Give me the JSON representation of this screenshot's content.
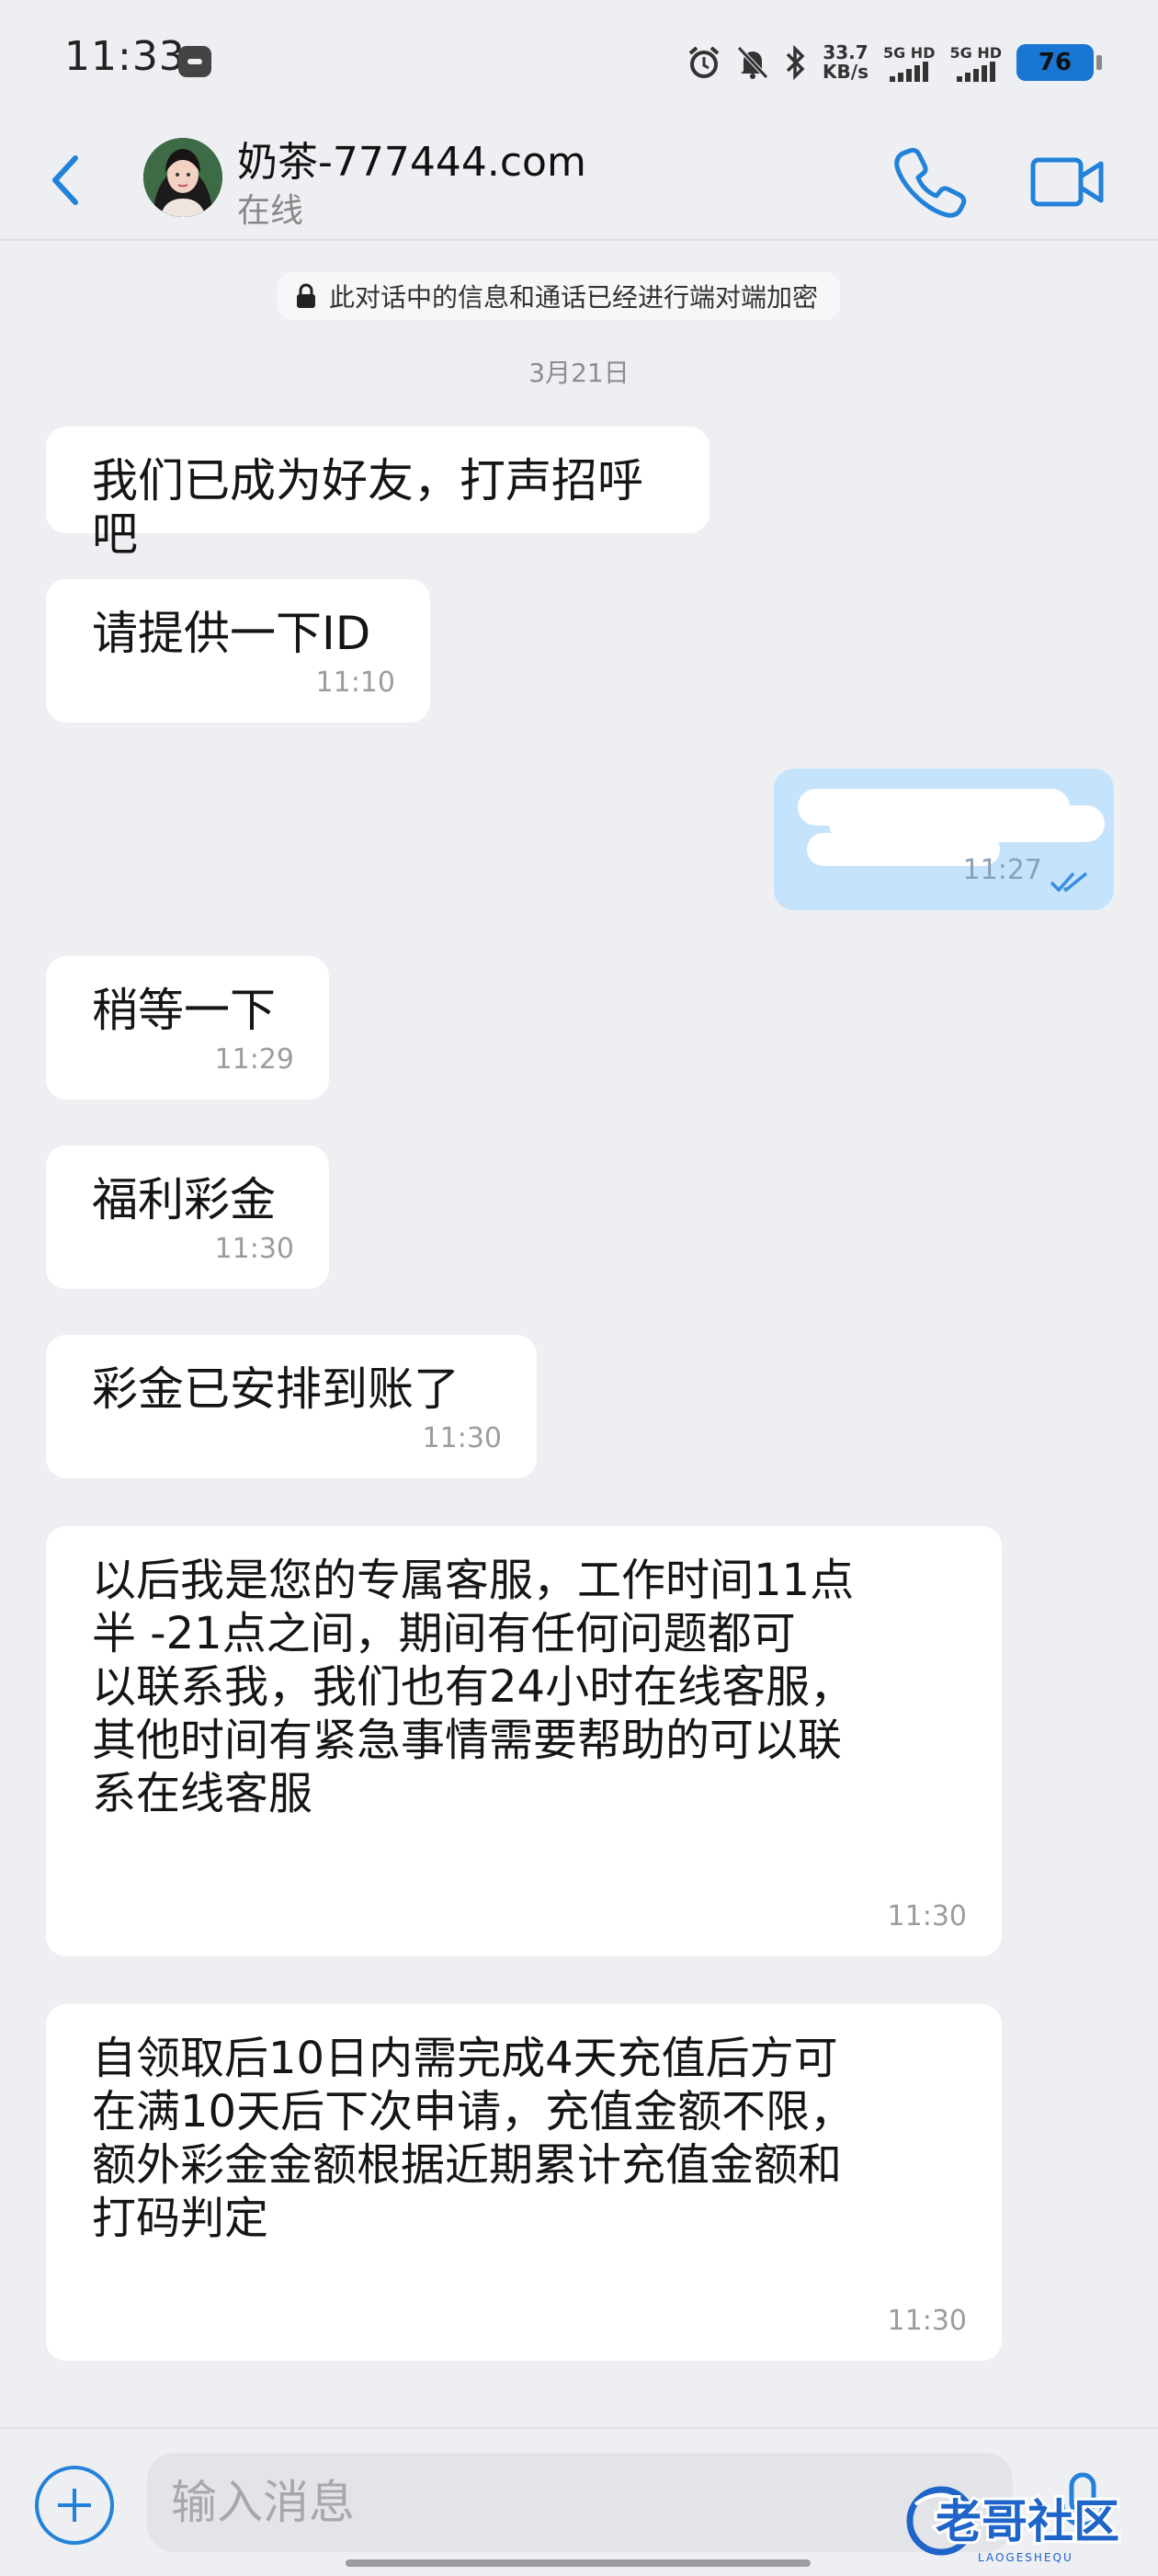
{
  "status_bar": {
    "time": "11:33",
    "net_speed_value": "33.7",
    "net_speed_unit": "KB/s",
    "sim1_label": "5G HD",
    "sim2_label": "5G HD",
    "battery_level": "76"
  },
  "header": {
    "contact_name": "奶茶-777444.com",
    "contact_status": "在线"
  },
  "chat": {
    "encryption_notice": "此对话中的信息和通话已经进行端对端加密",
    "date_separator": "3月21日",
    "messages": [
      {
        "direction": "in",
        "text": "我们已成为好友，打声招呼吧",
        "time": ""
      },
      {
        "direction": "in",
        "text": "请提供一下ID",
        "time": "11:10"
      },
      {
        "direction": "out",
        "text": "",
        "time": "11:27",
        "redacted": true,
        "read": true
      },
      {
        "direction": "in",
        "text": "稍等一下",
        "time": "11:29"
      },
      {
        "direction": "in",
        "text": "福利彩金",
        "time": "11:30"
      },
      {
        "direction": "in",
        "text": "彩金已安排到账了",
        "time": "11:30"
      },
      {
        "direction": "in",
        "text": "以后我是您的专属客服，工作时间11点\n半 -21点之间，期间有任何问题都可\n以联系我，我们也有24小时在线客服，\n其他时间有紧急事情需要帮助的可以联\n系在线客服",
        "time": "11:30"
      },
      {
        "direction": "in",
        "text": "自领取后10日内需完成4天充值后方可\n在满10天后下次申请，充值金额不限，\n额外彩金金额根据近期累计充值金额和\n打码判定",
        "time": "11:30"
      }
    ]
  },
  "input_bar": {
    "placeholder": "输入消息",
    "watermark": "老哥社区",
    "watermark_sub": "LAOGESHEQU"
  },
  "colors": {
    "accent": "#2281d9",
    "outgoing_bubble": "#c5e3fb",
    "incoming_bubble": "#ffffff",
    "background": "#eeeff3"
  },
  "icons": [
    "back-arrow-icon",
    "phone-icon",
    "video-camera-icon",
    "lock-icon",
    "double-check-icon",
    "plus-icon",
    "microphone-icon",
    "alarm-icon",
    "mute-bell-icon",
    "bluetooth-icon"
  ]
}
